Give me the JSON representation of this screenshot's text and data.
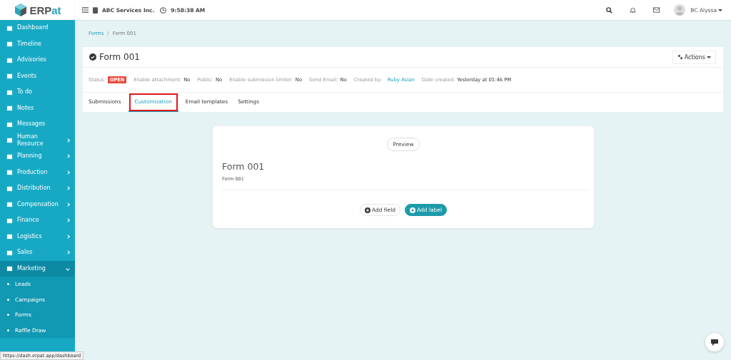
{
  "logo": {
    "part_1": "ERP",
    "part_2": "at"
  },
  "topbar": {
    "company": "ABC Services Inc.",
    "time": "9:58:38 AM",
    "user": "BC Alyssa"
  },
  "sidebar": {
    "items": [
      {
        "label": "Dashboard",
        "submenu": false
      },
      {
        "label": "Timeline",
        "submenu": false
      },
      {
        "label": "Advisories",
        "submenu": false
      },
      {
        "label": "Events",
        "submenu": false
      },
      {
        "label": "To do",
        "submenu": false
      },
      {
        "label": "Notes",
        "submenu": false
      },
      {
        "label": "Messages",
        "submenu": false
      },
      {
        "label": "Human Resource",
        "submenu": true,
        "expanded": false
      },
      {
        "label": "Planning",
        "submenu": true,
        "expanded": false
      },
      {
        "label": "Production",
        "submenu": true,
        "expanded": false
      },
      {
        "label": "Distribution",
        "submenu": true,
        "expanded": false
      },
      {
        "label": "Compensation",
        "submenu": true,
        "expanded": false
      },
      {
        "label": "Finance",
        "submenu": true,
        "expanded": false
      },
      {
        "label": "Logistics",
        "submenu": true,
        "expanded": false
      },
      {
        "label": "Sales",
        "submenu": true,
        "expanded": false
      },
      {
        "label": "Marketing",
        "submenu": true,
        "expanded": true,
        "children": [
          {
            "label": "Leads"
          },
          {
            "label": "Campaigns"
          },
          {
            "label": "Forms"
          },
          {
            "label": "Raffle Draw"
          }
        ]
      }
    ]
  },
  "breadcrumb": [
    {
      "label": "Forms",
      "kind": "link"
    },
    {
      "label": "/",
      "kind": "separator"
    },
    {
      "label": "Form 001",
      "kind": "current"
    }
  ],
  "form_header": {
    "title": "Form 001",
    "actions": "Actions",
    "meta": [
      {
        "label": "Status:",
        "kind": "badge",
        "value": "OPEN"
      },
      {
        "label": "Enable attachment:",
        "kind": "text",
        "value": "No"
      },
      {
        "label": "Public:",
        "kind": "text",
        "value": "No"
      },
      {
        "label": "Enable submission limiter:",
        "kind": "text",
        "value": "No"
      },
      {
        "label": "Send Email:",
        "kind": "text",
        "value": "No"
      },
      {
        "label": "Created by:",
        "kind": "link",
        "value": "Ruby Aslan"
      },
      {
        "label": "Date created:",
        "kind": "text",
        "value": "Yesterday at 01:46 PM"
      }
    ],
    "tabs": [
      {
        "label": "Submissions",
        "selected": false,
        "highlighted": false
      },
      {
        "label": "Customization",
        "selected": true,
        "highlighted": true
      },
      {
        "label": "Email templates",
        "selected": false,
        "highlighted": false
      },
      {
        "label": "Settings",
        "selected": false,
        "highlighted": false
      }
    ]
  },
  "form_preview": {
    "preview_button": "Preview",
    "title": "Form 001",
    "description": "Form 001",
    "buttons": [
      {
        "label": "Add field",
        "primary": false
      },
      {
        "label": "Add label",
        "primary": true
      }
    ]
  },
  "status_url": "https://dash.erpat.app/dashboard"
}
